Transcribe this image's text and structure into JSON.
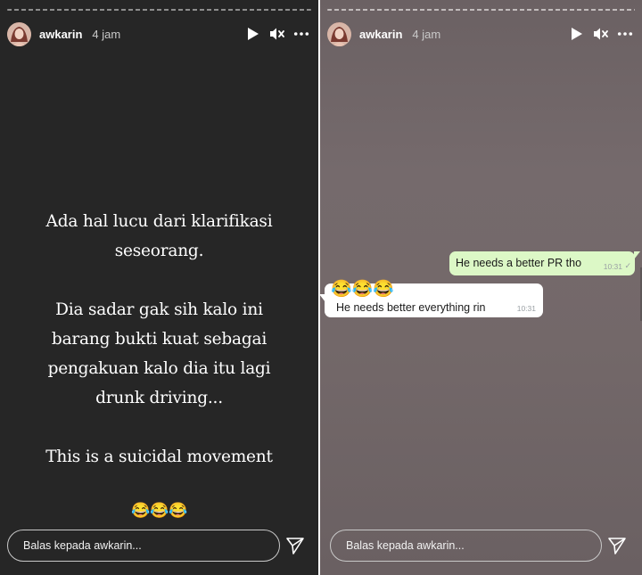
{
  "colors": {
    "left_bg": "#262626",
    "right_bg": "#736869",
    "bubble_out": "#dcf8c6",
    "bubble_in": "#ffffff"
  },
  "left_story": {
    "username": "awkarin",
    "time": "4 jam",
    "text": "Ada hal lucu dari klarifikasi\nseseorang.\n\nDia sadar gak sih kalo ini\nbarang bukti kuat sebagai\npengakuan kalo dia itu lagi\ndrunk driving...\n\nThis is a suicidal movement",
    "emojis": "😂😂😂",
    "reply_placeholder": "Balas kepada awkarin..."
  },
  "right_story": {
    "username": "awkarin",
    "time": "4 jam",
    "messages": [
      {
        "direction": "out",
        "text": "He needs a better PR tho",
        "time": "10:31",
        "status": "✓"
      },
      {
        "direction": "in",
        "emojis": "😂😂😂",
        "text": "He needs better everything rin",
        "time": "10:31"
      }
    ],
    "reply_placeholder": "Balas kepada awkarin..."
  },
  "icons": [
    "avatar",
    "play-icon",
    "mute-icon",
    "more-icon",
    "send-icon"
  ]
}
